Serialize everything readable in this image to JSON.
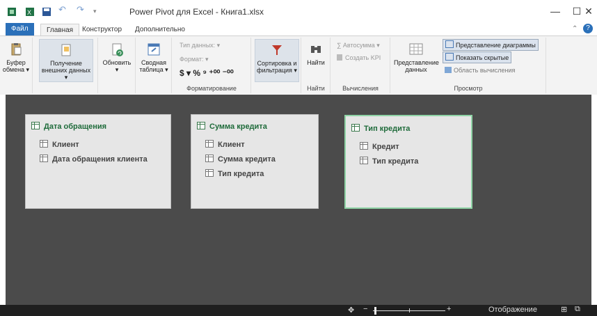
{
  "window": {
    "title": "Power Pivot для Excel - Книга1.xlsx",
    "controls": {
      "minimize": "—",
      "maximize": "☐",
      "close": "✕"
    }
  },
  "tabs": [
    {
      "label": "Файл"
    },
    {
      "label": "Главная"
    },
    {
      "label": "Конструктор"
    },
    {
      "label": "Дополнительно"
    }
  ],
  "ribbon": {
    "clipboard": {
      "label_line1": "Буфер",
      "label_line2": "обмена ▾"
    },
    "get_data": {
      "label_line1": "Получение",
      "label_line2": "внешних данных ▾"
    },
    "refresh": {
      "label_line1": "Обновить",
      "label_line2": "▾"
    },
    "pivot": {
      "label_line1": "Сводная",
      "label_line2": "таблица ▾"
    },
    "format": {
      "data_type": "Тип данных: ▾",
      "format": "Формат: ▾",
      "symbols": "$ ▾ %  ⁹  ⁺⁰⁰ ⁻⁰⁰",
      "group_label": "Форматирование"
    },
    "sort": {
      "label_line1": "Сортировка и",
      "label_line2": "фильтрация ▾"
    },
    "find": {
      "label": "Найти",
      "group_label": "Найти"
    },
    "calc": {
      "autosum": "∑ Автосумма ▾",
      "kpi": "Создать KPI",
      "group_label": "Вычисления"
    },
    "view": {
      "data_view_line1": "Представление",
      "data_view_line2": "данных",
      "diagram_view": "Представление диаграммы",
      "show_hidden": "Показать скрытые",
      "calc_area": "Область вычисления",
      "group_label": "Просмотр"
    }
  },
  "tables": [
    {
      "title": "Дата обращения",
      "fields": [
        "Клиент",
        "Дата обращения клиента"
      ]
    },
    {
      "title": "Сумма кредита",
      "fields": [
        "Клиент",
        "Сумма кредита",
        "Тип кредита"
      ]
    },
    {
      "title": "Тип кредита",
      "fields": [
        "Кредит",
        "Тип кредита"
      ]
    }
  ],
  "status": {
    "minus": "−",
    "plus": "+",
    "display_label": "Отображение"
  }
}
